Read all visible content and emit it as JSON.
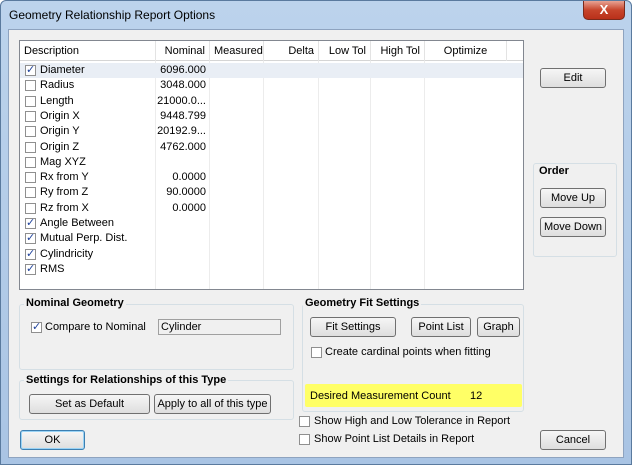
{
  "window": {
    "title": "Geometry Relationship Report Options",
    "close_glyph": "X"
  },
  "list": {
    "columns": [
      "Description",
      "Nominal",
      "Measured",
      "Delta",
      "Low Tol",
      "High Tol",
      "Optimize"
    ],
    "rows": [
      {
        "checked": true,
        "description": "Diameter",
        "nominal": "6096.000"
      },
      {
        "checked": false,
        "description": "Radius",
        "nominal": "3048.000"
      },
      {
        "checked": false,
        "description": "Length",
        "nominal": "21000.0..."
      },
      {
        "checked": false,
        "description": "Origin X",
        "nominal": "9448.799"
      },
      {
        "checked": false,
        "description": "Origin Y",
        "nominal": "20192.9..."
      },
      {
        "checked": false,
        "description": "Origin Z",
        "nominal": "4762.000"
      },
      {
        "checked": false,
        "description": "Mag XYZ",
        "nominal": ""
      },
      {
        "checked": false,
        "description": "Rx from Y",
        "nominal": "0.0000"
      },
      {
        "checked": false,
        "description": "Ry from Z",
        "nominal": "90.0000"
      },
      {
        "checked": false,
        "description": "Rz from X",
        "nominal": "0.0000"
      },
      {
        "checked": true,
        "description": "Angle Between",
        "nominal": ""
      },
      {
        "checked": true,
        "description": "Mutual Perp. Dist.",
        "nominal": ""
      },
      {
        "checked": true,
        "description": "Cylindricity",
        "nominal": ""
      },
      {
        "checked": true,
        "description": "RMS",
        "nominal": ""
      }
    ]
  },
  "buttons": {
    "edit": "Edit",
    "move_up": "Move Up",
    "move_down": "Move Down",
    "fit_settings": "Fit Settings",
    "point_list": "Point List",
    "graph": "Graph",
    "set_default": "Set as Default",
    "apply_all": "Apply to all of this type",
    "ok": "OK",
    "cancel": "Cancel"
  },
  "order": {
    "label": "Order"
  },
  "nominal_geometry": {
    "label": "Nominal Geometry",
    "compare_label": "Compare to Nominal",
    "compare_checked": true,
    "geometry_value": "Cylinder"
  },
  "settings_type": {
    "label": "Settings for Relationships of this Type"
  },
  "fit": {
    "label": "Geometry Fit Settings",
    "cardinal_label": "Create cardinal points when fitting",
    "cardinal_checked": false,
    "desired_count_label": "Desired Measurement Count",
    "desired_count_value": "12"
  },
  "options": {
    "show_tol_label": "Show High and Low Tolerance in Report",
    "show_tol_checked": false,
    "show_points_label": "Show Point List Details in Report",
    "show_points_checked": false
  },
  "colors": {
    "highlight": "#ffff66",
    "check": "#21439c"
  }
}
